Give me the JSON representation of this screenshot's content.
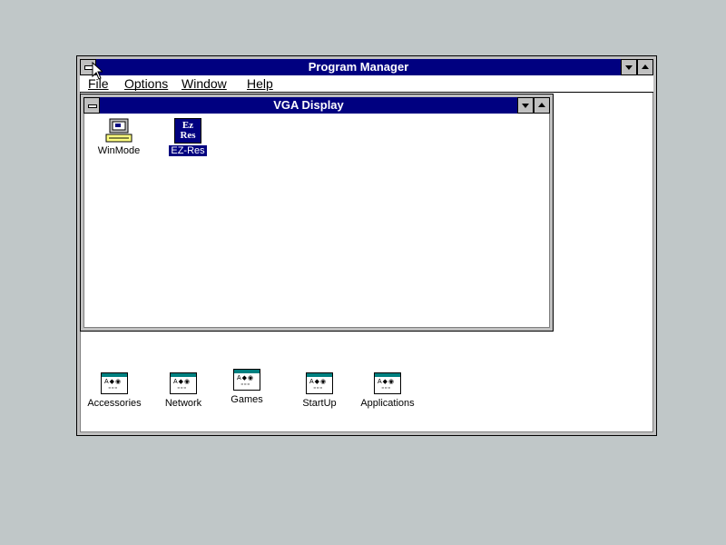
{
  "program_manager": {
    "title": "Program Manager",
    "menus": [
      {
        "label": "File"
      },
      {
        "label": "Options"
      },
      {
        "label": "Window"
      },
      {
        "label": "Help"
      }
    ]
  },
  "vga_window": {
    "title": "VGA Display",
    "icons": [
      {
        "label": "WinMode",
        "icon": "monitor-icon",
        "selected": false
      },
      {
        "label": "EZ-Res",
        "icon": "ez-res-icon",
        "selected": true
      }
    ],
    "ezres_glyph_top": "Ez",
    "ezres_glyph_bottom": "Res"
  },
  "groups": [
    {
      "label": "Accessories"
    },
    {
      "label": "Network"
    },
    {
      "label": "Games"
    },
    {
      "label": "StartUp"
    },
    {
      "label": "Applications"
    }
  ],
  "colors": {
    "desktop": "#c0c7c8",
    "title_active": "#000080",
    "selection": "#000080"
  }
}
